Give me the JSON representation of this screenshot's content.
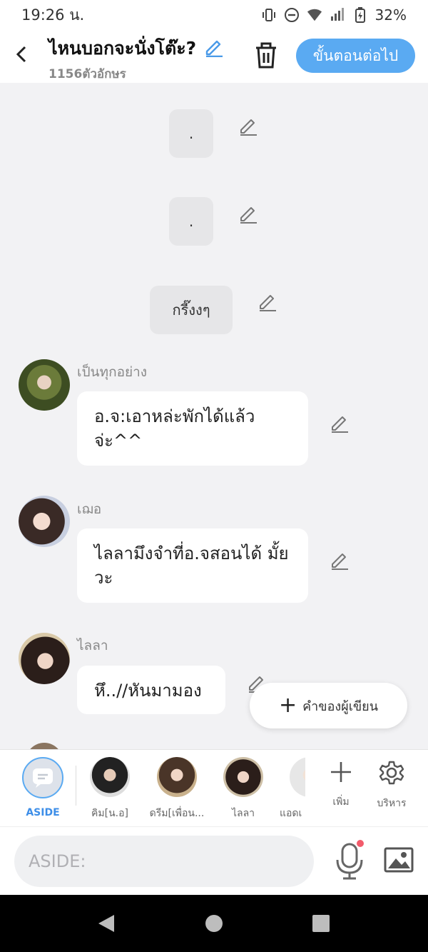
{
  "status_bar": {
    "time": "19:26 น.",
    "battery": "32%"
  },
  "header": {
    "title": "ไหนบอกจะนั่งโต๊ะ?",
    "subtitle": "1156ตัวอักษร",
    "next_button": "ขั้นตอนต่อไป"
  },
  "messages": [
    {
      "type": "narration",
      "text": "."
    },
    {
      "type": "narration",
      "text": "."
    },
    {
      "type": "narration",
      "text": "กรี๊งงๆ"
    },
    {
      "type": "chat",
      "sender": "เป็นทุกอย่าง",
      "text": "อ.จ:เอาหล่ะพักได้แล้ว จ่ะ^^"
    },
    {
      "type": "chat",
      "sender": "เฌอ",
      "text": "ไลลามึงจำที่อ.จสอนได้ มั้ยวะ"
    },
    {
      "type": "chat",
      "sender": "ไลลา",
      "text": "หึ..//หันมามอง"
    }
  ],
  "author_note_button": "คำของผู้เขียน",
  "characters": [
    {
      "label": "ASIDE"
    },
    {
      "label": "คิม[น.อ]"
    },
    {
      "label": "ดรีม[เพื่อน..."
    },
    {
      "label": "ไลลา"
    },
    {
      "label": "แอดเ"
    }
  ],
  "tools": {
    "add_label": "เพิ่ม",
    "manage_label": "บริหาร"
  },
  "input": {
    "placeholder": "ASIDE:"
  },
  "colors": {
    "accent": "#5aaaf2",
    "background": "#f2f2f4",
    "notification_dot": "#f25b6b"
  }
}
